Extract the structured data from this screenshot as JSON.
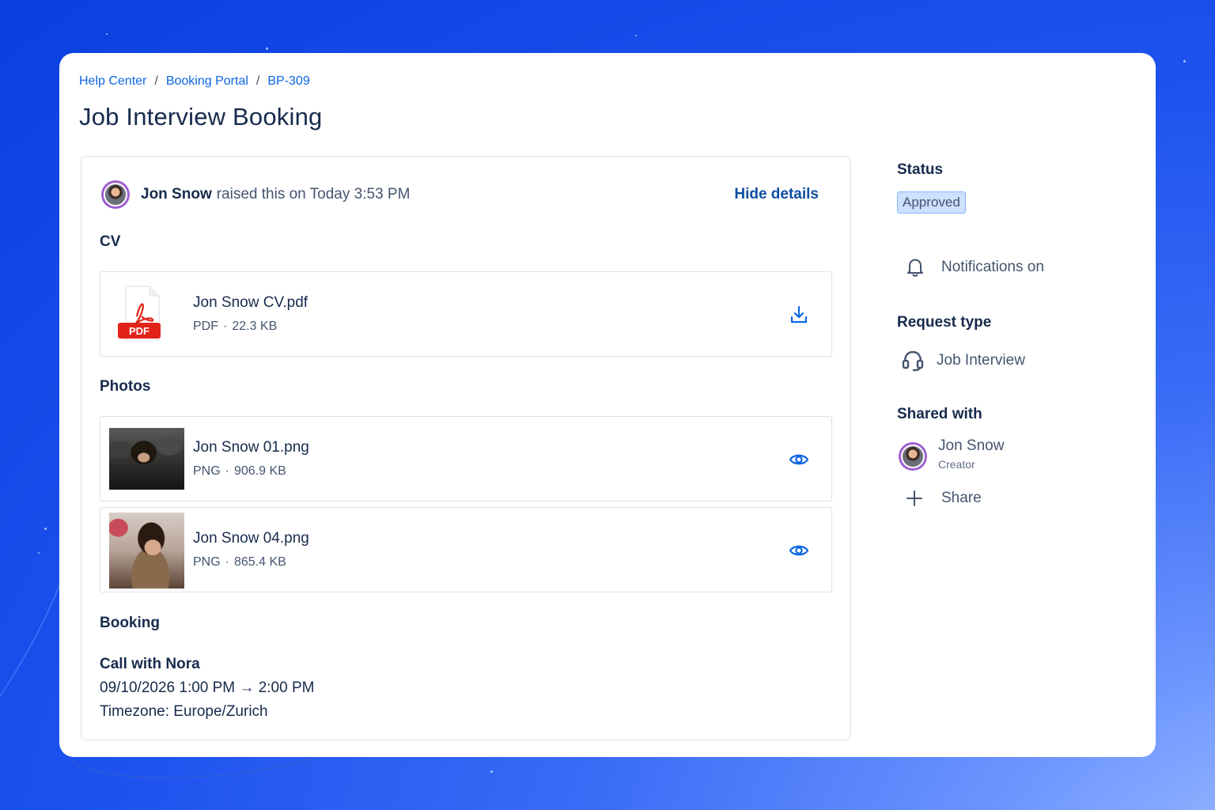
{
  "breadcrumb": {
    "items": [
      "Help Center",
      "Booking Portal",
      "BP-309"
    ],
    "separator": "/"
  },
  "page_title": "Job Interview Booking",
  "request": {
    "author": "Jon Snow",
    "raised_text": "raised this on Today 3:53 PM",
    "hide_details_label": "Hide details"
  },
  "cv": {
    "label": "CV",
    "file": {
      "name": "Jon Snow CV.pdf",
      "type": "PDF",
      "size": "22.3 KB",
      "separator": "·",
      "badge": "PDF",
      "action_icon": "download-icon"
    }
  },
  "photos": {
    "label": "Photos",
    "files": [
      {
        "name": "Jon Snow 01.png",
        "type": "PNG",
        "size": "906.9 KB",
        "separator": "·",
        "action_icon": "eye-icon"
      },
      {
        "name": "Jon Snow 04.png",
        "type": "PNG",
        "size": "865.4 KB",
        "separator": "·",
        "action_icon": "eye-icon"
      }
    ]
  },
  "booking": {
    "label": "Booking",
    "title": "Call with Nora",
    "start": "09/10/2026 1:00 PM",
    "arrow": "→",
    "end": "2:00 PM",
    "timezone": "Timezone: Europe/Zurich"
  },
  "sidebar": {
    "status_label": "Status",
    "status_value": "Approved",
    "notifications_label": "Notifications on",
    "request_type_label": "Request type",
    "request_type_value": "Job Interview",
    "shared_with_label": "Shared with",
    "shared_user": {
      "name": "Jon Snow",
      "role": "Creator"
    },
    "share_label": "Share"
  },
  "colors": {
    "link": "#0c66e4",
    "status_badge_bg": "#cce0ff",
    "status_badge_border": "#85b8ff",
    "background_blue": "#1d52ee",
    "pdf_red": "#e2231a",
    "icon_blue": "#0c66e4"
  }
}
